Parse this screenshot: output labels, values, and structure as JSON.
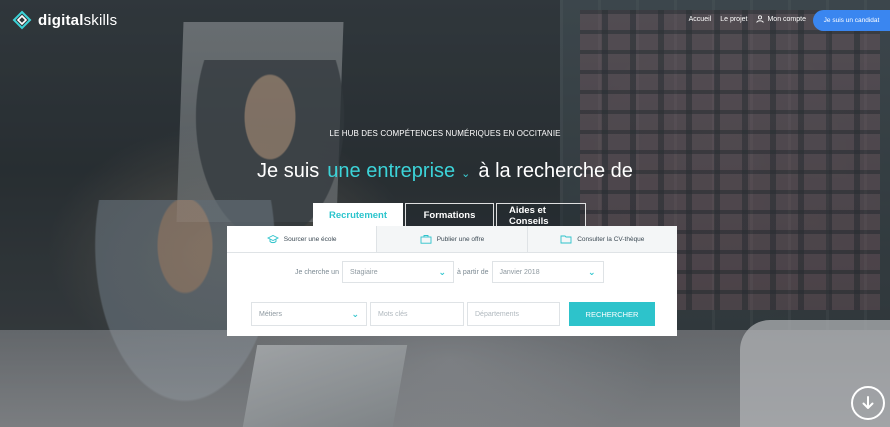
{
  "brand": {
    "name_bold": "digital",
    "name_light": "skills"
  },
  "nav": {
    "items": [
      "Accueil",
      "Le projet",
      "Mon compte"
    ],
    "cta": "Je suis un candidat"
  },
  "hero": {
    "tagline": "LE HUB DES COMPÉTENCES NUMÉRIQUES EN OCCITANIE",
    "prefix": "Je suis",
    "choice": "une entreprise",
    "suffix": "à la recherche de"
  },
  "tabs": [
    "Recrutement",
    "Formations",
    "Aides et Conseils"
  ],
  "active_tab": "Recrutement",
  "subtabs": [
    "Sourcer une école",
    "Publier une offre",
    "Consulter la CV-thèque"
  ],
  "form": {
    "label_search": "Je cherche un",
    "type_value": "Stagiaire",
    "label_from": "à partir de",
    "date_value": "Janvier 2018",
    "metiers_value": "Métiers",
    "keywords_placeholder": "Mots clés",
    "departments_placeholder": "Départements",
    "search_button": "RECHERCHER"
  },
  "colors": {
    "accent": "#2dc3cb",
    "cta_blue": "#3a86f0",
    "text_dark": "#3c4a54"
  },
  "icons": {
    "logo": "diamond-logo-icon",
    "account": "user-icon",
    "school": "graduation-cap-icon",
    "offer": "briefcase-icon",
    "cvtheque": "folder-icon",
    "scroll": "arrow-down-circle-icon"
  }
}
